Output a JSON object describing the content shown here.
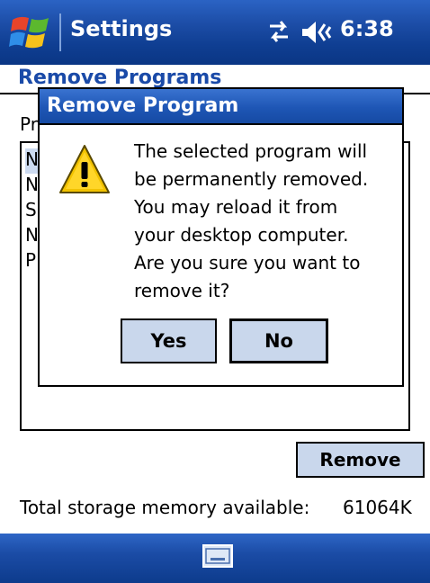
{
  "title_bar": {
    "app_title": "Settings",
    "clock": "6:38"
  },
  "page": {
    "title": "Remove Programs",
    "programs_label": "Pr",
    "list_items": [
      "N",
      "N",
      "S",
      "N",
      "P"
    ],
    "remove_button": "Remove",
    "storage_label": "Total storage memory available:",
    "storage_value": "61064K"
  },
  "dialog": {
    "title": "Remove Program",
    "message_lines": [
      "The selected program will",
      "be permanently removed.",
      "You may reload it from",
      "your desktop computer.",
      "Are you sure you want to",
      "remove it?"
    ],
    "yes_button": "Yes",
    "no_button": "No"
  },
  "colors": {
    "title_bar": "#1d4ea8",
    "page_title": "#1a4aa8",
    "button_face": "#c9d7ec",
    "warning": "#f2c200"
  }
}
